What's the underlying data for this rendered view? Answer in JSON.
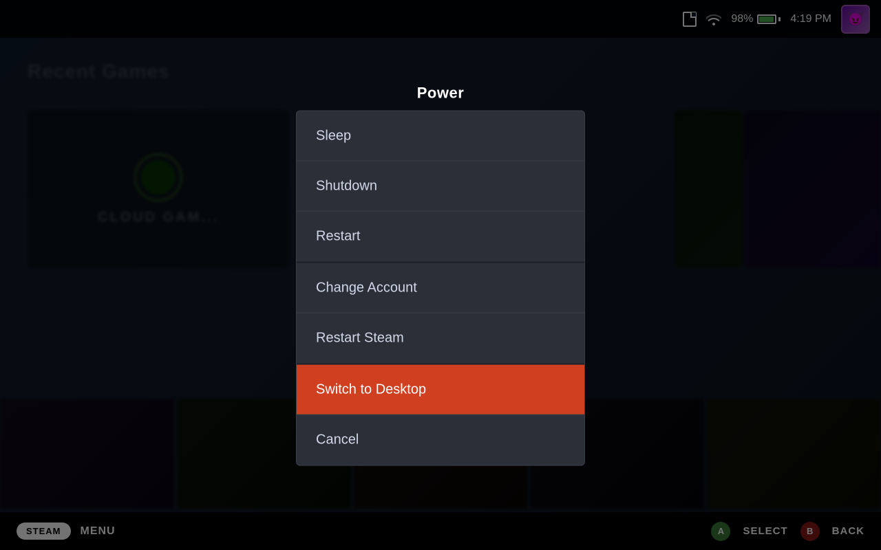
{
  "statusBar": {
    "battery_percent": "98%",
    "time": "4:19 PM"
  },
  "background": {
    "recent_games_label": "Recent Games"
  },
  "dialog": {
    "title": "Power",
    "items": [
      {
        "id": "sleep",
        "label": "Sleep",
        "highlighted": false
      },
      {
        "id": "shutdown",
        "label": "Shutdown",
        "highlighted": false
      },
      {
        "id": "restart",
        "label": "Restart",
        "highlighted": false
      },
      {
        "id": "change-account",
        "label": "Change Account",
        "highlighted": false
      },
      {
        "id": "restart-steam",
        "label": "Restart Steam",
        "highlighted": false
      },
      {
        "id": "switch-desktop",
        "label": "Switch to Desktop",
        "highlighted": true
      },
      {
        "id": "cancel",
        "label": "Cancel",
        "highlighted": false
      }
    ]
  },
  "taskbar": {
    "steam_label": "STEAM",
    "menu_label": "MENU",
    "select_label": "SELECT",
    "back_label": "BACK",
    "a_button": "A",
    "b_button": "B"
  }
}
